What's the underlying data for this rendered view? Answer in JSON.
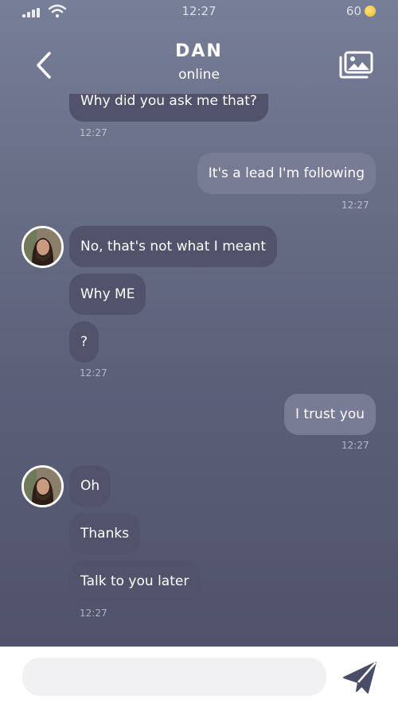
{
  "status_bar": {
    "time": "12:27",
    "coins": "60"
  },
  "header": {
    "contact_name": "DAN",
    "contact_status": "online"
  },
  "messages": {
    "m0": {
      "text": "Why did you ask me that?",
      "time": "12:27"
    },
    "m1": {
      "text": "It's a lead I'm following",
      "time": "12:27"
    },
    "m2": {
      "text": "No, that's not what I meant"
    },
    "m3": {
      "text": "Why ME"
    },
    "m4": {
      "text": "?",
      "time": "12:27"
    },
    "m5": {
      "text": "I trust you",
      "time": "12:27"
    },
    "m6": {
      "text": "Oh"
    },
    "m7": {
      "text": "Thanks"
    },
    "m8": {
      "text": "Talk to you later",
      "time": "12:27"
    }
  },
  "composer": {
    "placeholder": ""
  },
  "colors": {
    "incoming_bubble": "#50536a",
    "outgoing_bubble": "#777b93",
    "send_icon": "#4a4d66"
  },
  "icons": {
    "back": "chevron-left-icon",
    "gallery": "gallery-icon",
    "send": "send-icon",
    "coin": "coin-icon"
  }
}
